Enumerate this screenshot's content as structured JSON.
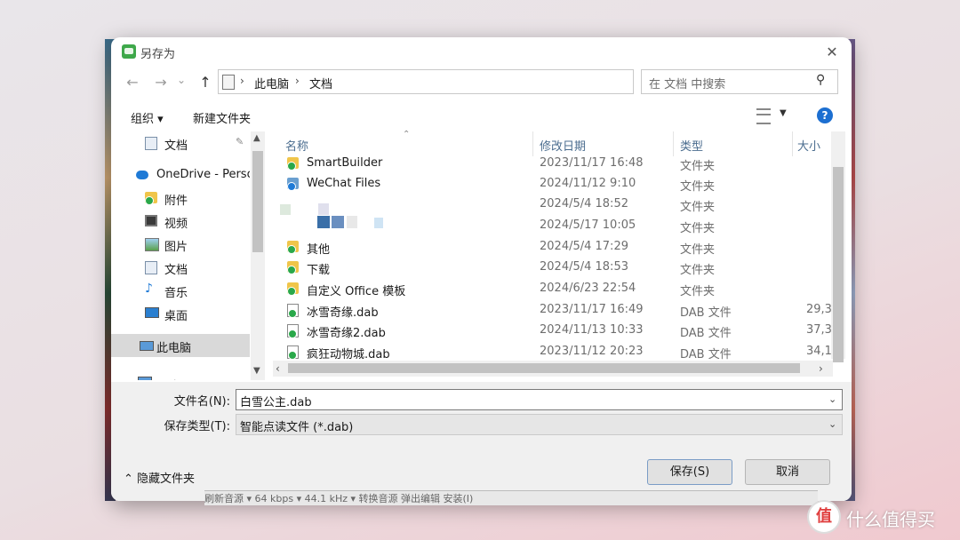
{
  "window": {
    "title": "另存为",
    "close_glyph": "✕"
  },
  "nav": {
    "back_glyph": "←",
    "forward_glyph": "→",
    "recent_glyph": "⌄",
    "up_glyph": "↑",
    "path": [
      "此电脑",
      "文档"
    ],
    "refresh_glyph": "↻",
    "search_placeholder": "在 文档 中搜索"
  },
  "toolbar": {
    "organize": "组织 ▾",
    "new_folder": "新建文件夹",
    "help": "?"
  },
  "nav_pane": {
    "items": [
      {
        "label": "文档",
        "icon": "documents-icon",
        "pinned": true
      },
      {
        "label": "OneDrive - Perso",
        "icon": "cloud-icon"
      },
      {
        "label": "附件",
        "icon": "folder-icon"
      },
      {
        "label": "视频",
        "icon": "videos-icon"
      },
      {
        "label": "图片",
        "icon": "pictures-icon"
      },
      {
        "label": "文档",
        "icon": "documents-icon"
      },
      {
        "label": "音乐",
        "icon": "music-icon"
      },
      {
        "label": "桌面",
        "icon": "desktop-icon"
      },
      {
        "label": "此电脑",
        "icon": "computer-icon",
        "selected": true
      },
      {
        "label": "网络",
        "icon": "network-icon"
      }
    ]
  },
  "columns": {
    "name": "名称",
    "date": "修改日期",
    "type": "类型",
    "size": "大小"
  },
  "files": [
    {
      "name": "SmartBuilder",
      "date": "2023/11/17 16:48",
      "type": "文件夹",
      "size": "",
      "kind": "folder"
    },
    {
      "name": "WeChat Files",
      "date": "2024/11/12 9:10",
      "type": "文件夹",
      "size": "",
      "kind": "folder"
    },
    {
      "name": "",
      "date": "2024/5/4 18:52",
      "type": "文件夹",
      "size": "",
      "kind": "blurred"
    },
    {
      "name": "",
      "date": "2024/5/17 10:05",
      "type": "文件夹",
      "size": "",
      "kind": "blurred"
    },
    {
      "name": "其他",
      "date": "2024/5/4 17:29",
      "type": "文件夹",
      "size": "",
      "kind": "folder"
    },
    {
      "name": "下载",
      "date": "2024/5/4 18:53",
      "type": "文件夹",
      "size": "",
      "kind": "folder"
    },
    {
      "name": "自定义 Office 模板",
      "date": "2024/6/23 22:54",
      "type": "文件夹",
      "size": "",
      "kind": "folder"
    },
    {
      "name": "冰雪奇缘.dab",
      "date": "2023/11/17 16:49",
      "type": "DAB 文件",
      "size": "29,3",
      "kind": "file"
    },
    {
      "name": "冰雪奇缘2.dab",
      "date": "2024/11/13 10:33",
      "type": "DAB 文件",
      "size": "37,3",
      "kind": "file"
    },
    {
      "name": "疯狂动物城.dab",
      "date": "2023/11/12 20:23",
      "type": "DAB 文件",
      "size": "34,1",
      "kind": "file"
    }
  ],
  "save_form": {
    "filename_label": "文件名(N):",
    "filename_value": "白雪公主.dab",
    "type_label": "保存类型(T):",
    "type_value": "智能点读文件 (*.dab)",
    "hide_folders": "⌃ 隐藏文件夹",
    "save_button": "保存(S)",
    "cancel_button": "取消"
  },
  "background_strip": "刷新音源   ▾   64 kbps  ▾  44.1 kHz  ▾  转换音源      弹出编辑     安装(I)",
  "watermark": {
    "logo": "值",
    "text": "什么值得买"
  },
  "colors": {
    "accent": "#1c6fd1",
    "folder": "#f0c54a",
    "sync_badge": "#2aa84a",
    "header_text": "#4b6d8f"
  }
}
